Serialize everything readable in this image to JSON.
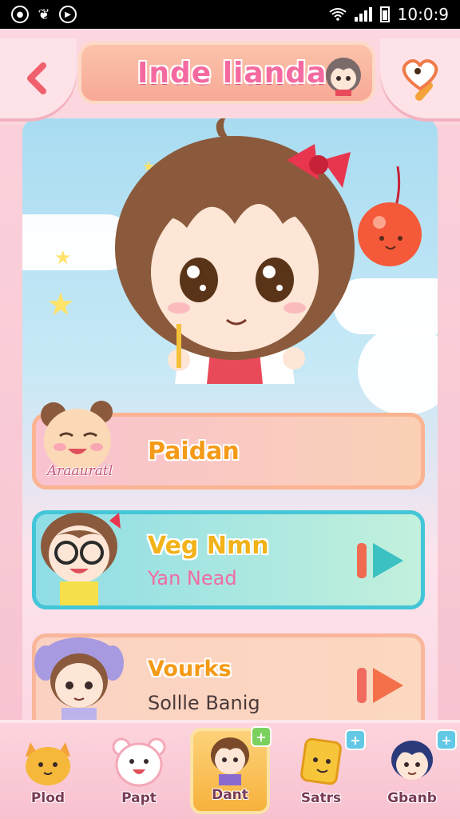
{
  "status_bar": {
    "time": "10:0:9"
  },
  "header": {
    "title": "Inde lianda",
    "back_icon": "chevron-left-icon",
    "fav_icon": "heart-bubble-icon"
  },
  "cards": [
    {
      "title": "Paidan",
      "subtitle": "",
      "label": "Araauratl",
      "action": "none"
    },
    {
      "title": "Veg Nmn",
      "subtitle": "Yan Nead",
      "action": "play"
    },
    {
      "title": "Vourks",
      "subtitle": "Sollle Banig",
      "action": "play"
    }
  ],
  "nav": [
    {
      "label": "Plod",
      "icon": "orange-cat-icon"
    },
    {
      "label": "Papt",
      "icon": "white-bear-icon"
    },
    {
      "label": "Dant",
      "icon": "boy-avatar-icon",
      "active": true,
      "badge": "+"
    },
    {
      "label": "Satrs",
      "icon": "yellow-block-icon",
      "badge": "+"
    },
    {
      "label": "Gbanb",
      "icon": "blue-hair-avatar-icon",
      "badge": "+"
    }
  ],
  "colors": {
    "accent_pink": "#f46aa0",
    "accent_orange": "#f49a17",
    "teal": "#42c6d8"
  }
}
